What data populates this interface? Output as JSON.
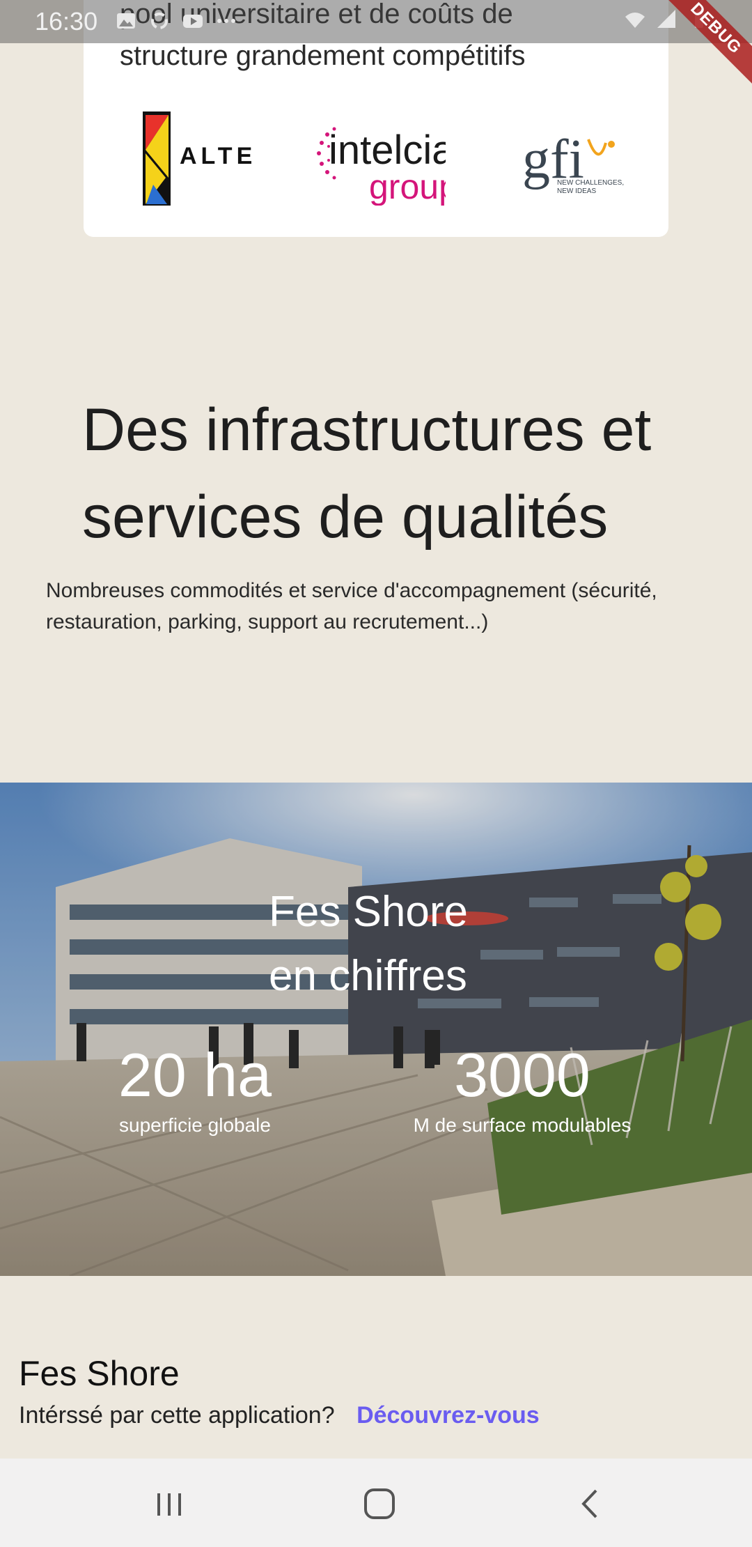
{
  "status_bar": {
    "time": "16:30",
    "ribbon": "DEBUG"
  },
  "partners": {
    "text_line1": "pool universitaire et de coûts de",
    "text_line2": "structure grandement compétitifs",
    "logos": [
      {
        "name": "alten-logo",
        "text": "ALTEN"
      },
      {
        "name": "intelcia-logo",
        "text": "intelcia",
        "subtext": "group"
      },
      {
        "name": "gfi-logo",
        "text": "gfi",
        "tagline1": "NEW CHALLENGES,",
        "tagline2": "NEW IDEAS"
      }
    ]
  },
  "infrastructure": {
    "title_line1": "Des infrastructures et",
    "title_line2": "services de qualités",
    "description": "Nombreuses commodités et service d'accompagnement (sécurité, restauration, parking, support au recrutement...)"
  },
  "figures": {
    "title_line1": "Fes Shore",
    "title_line2": "en chiffres",
    "stats": [
      {
        "value": "20 ha",
        "label": "superficie globale"
      },
      {
        "value": "3000",
        "label": "M de surface modulables"
      }
    ]
  },
  "footer": {
    "title": "Fes Shore",
    "prompt": "Intérssé par cette application?",
    "link": "Découvrez-vous"
  },
  "colors": {
    "background": "#EDE8DE",
    "card": "#FFFFFF",
    "link": "#6A5CF0",
    "nav_bar": "#F2F1F1"
  }
}
